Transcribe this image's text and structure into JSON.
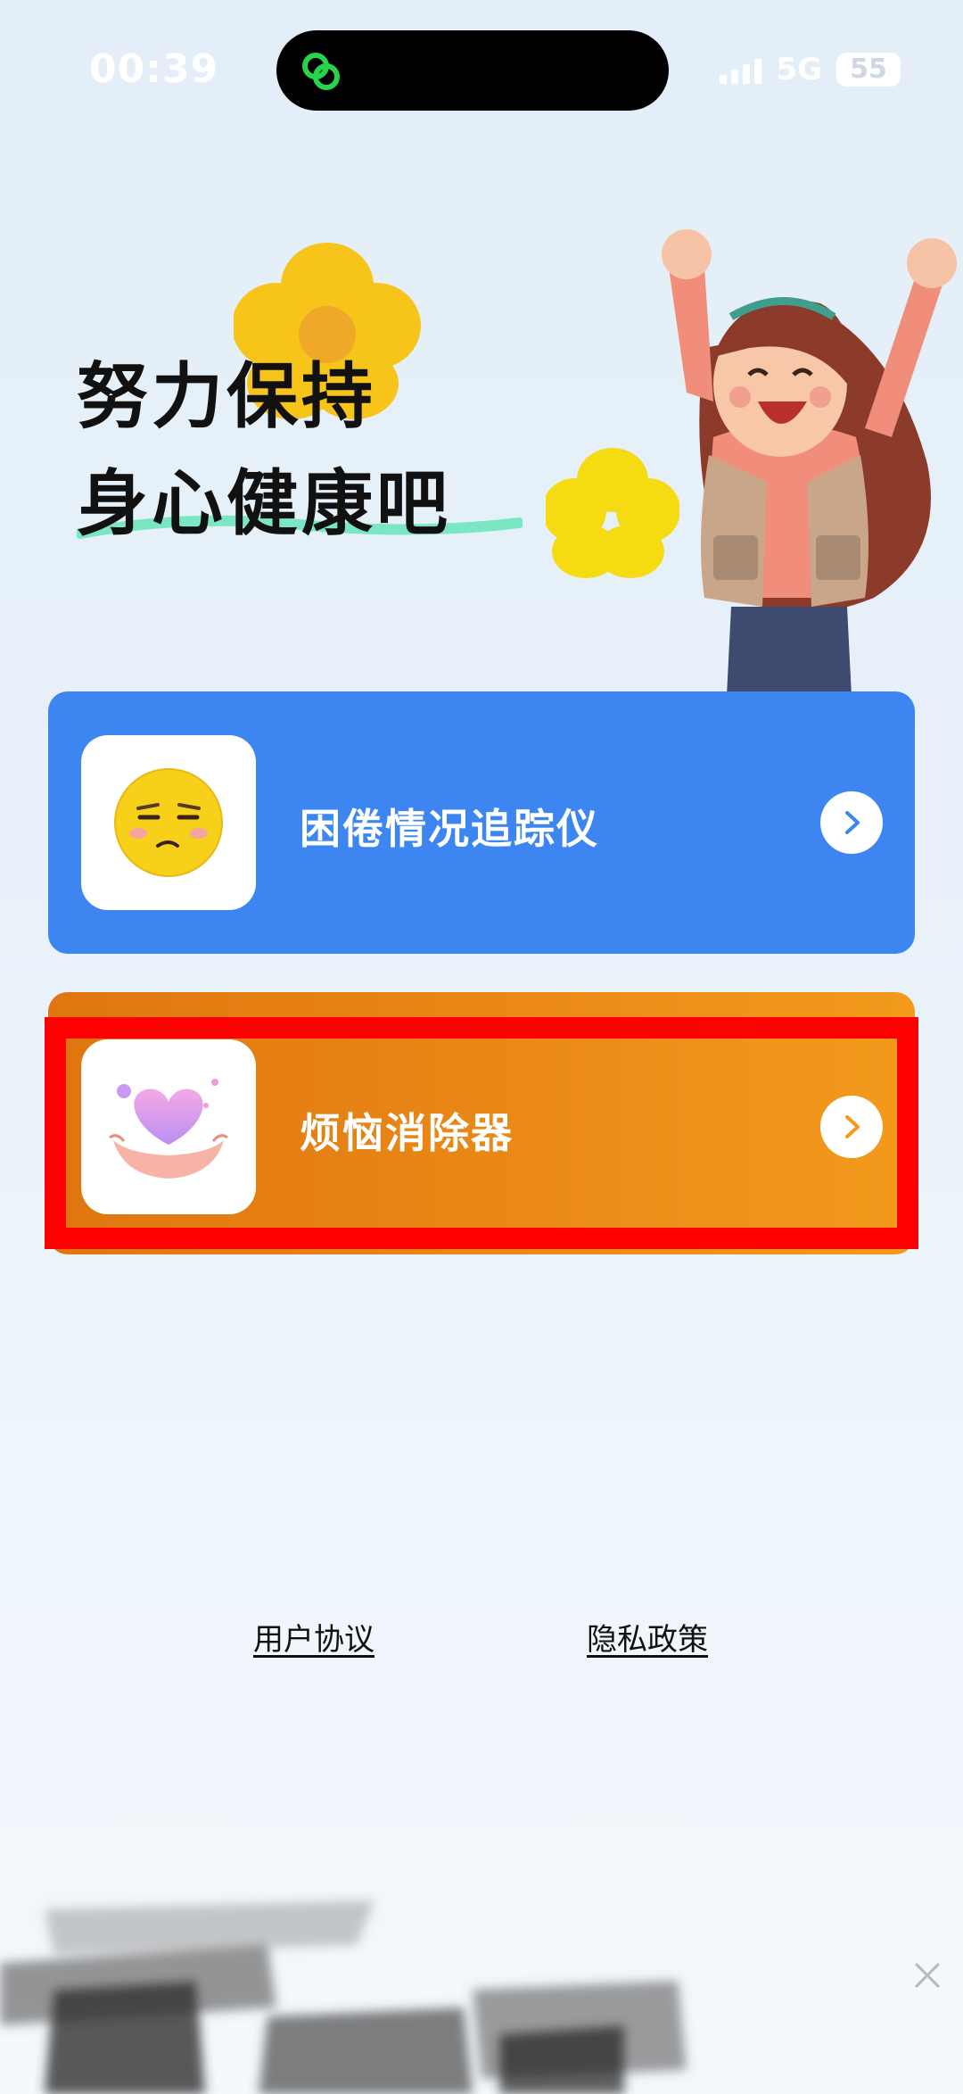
{
  "status_bar": {
    "time": "00:39",
    "network": "5G",
    "battery": "55",
    "island_icon": "link-rings-icon"
  },
  "hero": {
    "line1": "努力保持",
    "line2": "身心健康吧"
  },
  "cards": [
    {
      "label": "困倦情况追踪仪",
      "icon": "sleepy-face-icon",
      "color": "#3d86f2"
    },
    {
      "label": "烦恼消除器",
      "icon": "heart-in-hands-icon",
      "color": "#f39a1c"
    }
  ],
  "footer": {
    "user_agreement": "用户协议",
    "privacy_policy": "隐私政策"
  },
  "colors": {
    "accent_blue": "#3d86f2",
    "accent_orange": "#f39a1c",
    "highlight": "#ff0000"
  }
}
